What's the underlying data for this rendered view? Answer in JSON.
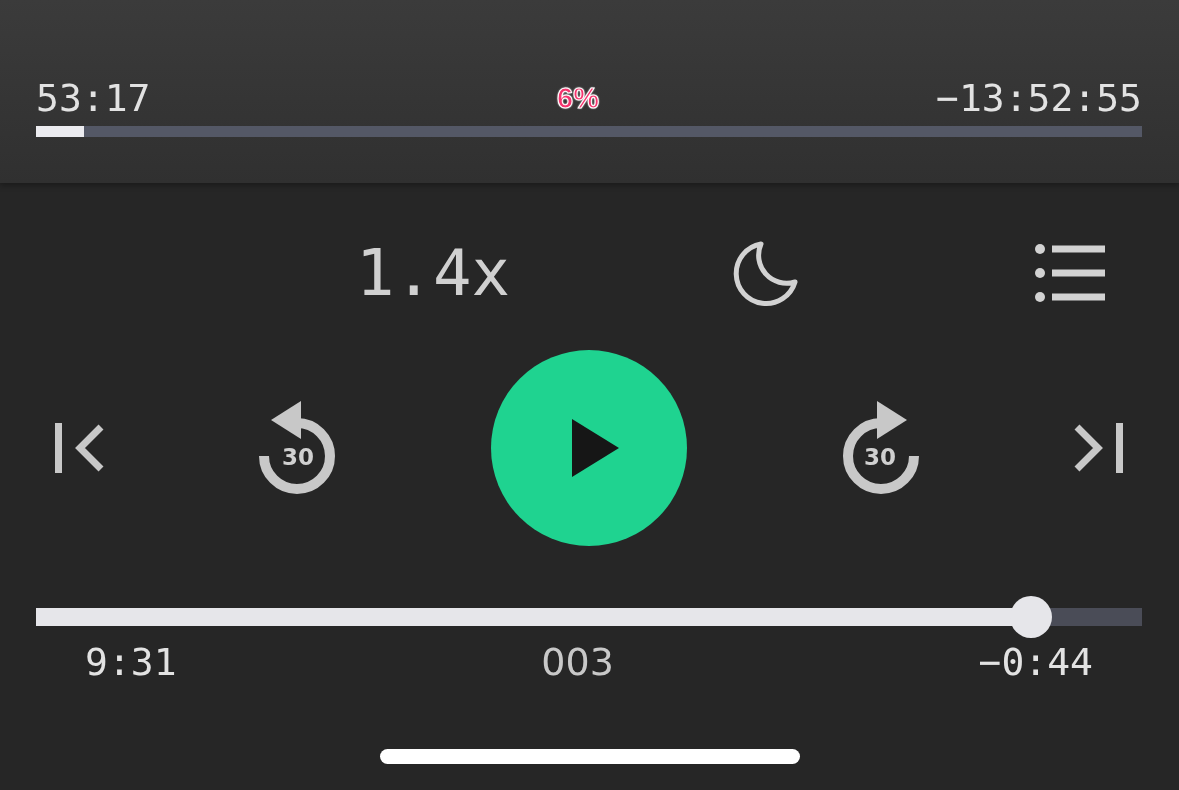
{
  "book_progress": {
    "elapsed": "53:17",
    "percent": "6%",
    "remaining": "−13:52:55",
    "level": 0.043
  },
  "toolbar": {
    "speed": "1.4x"
  },
  "controls": {
    "skip_back": "30",
    "skip_forward": "30",
    "playing": false
  },
  "chapter": {
    "level": 0.9,
    "elapsed": "9:31",
    "title": "003",
    "remaining": "−0:44"
  }
}
